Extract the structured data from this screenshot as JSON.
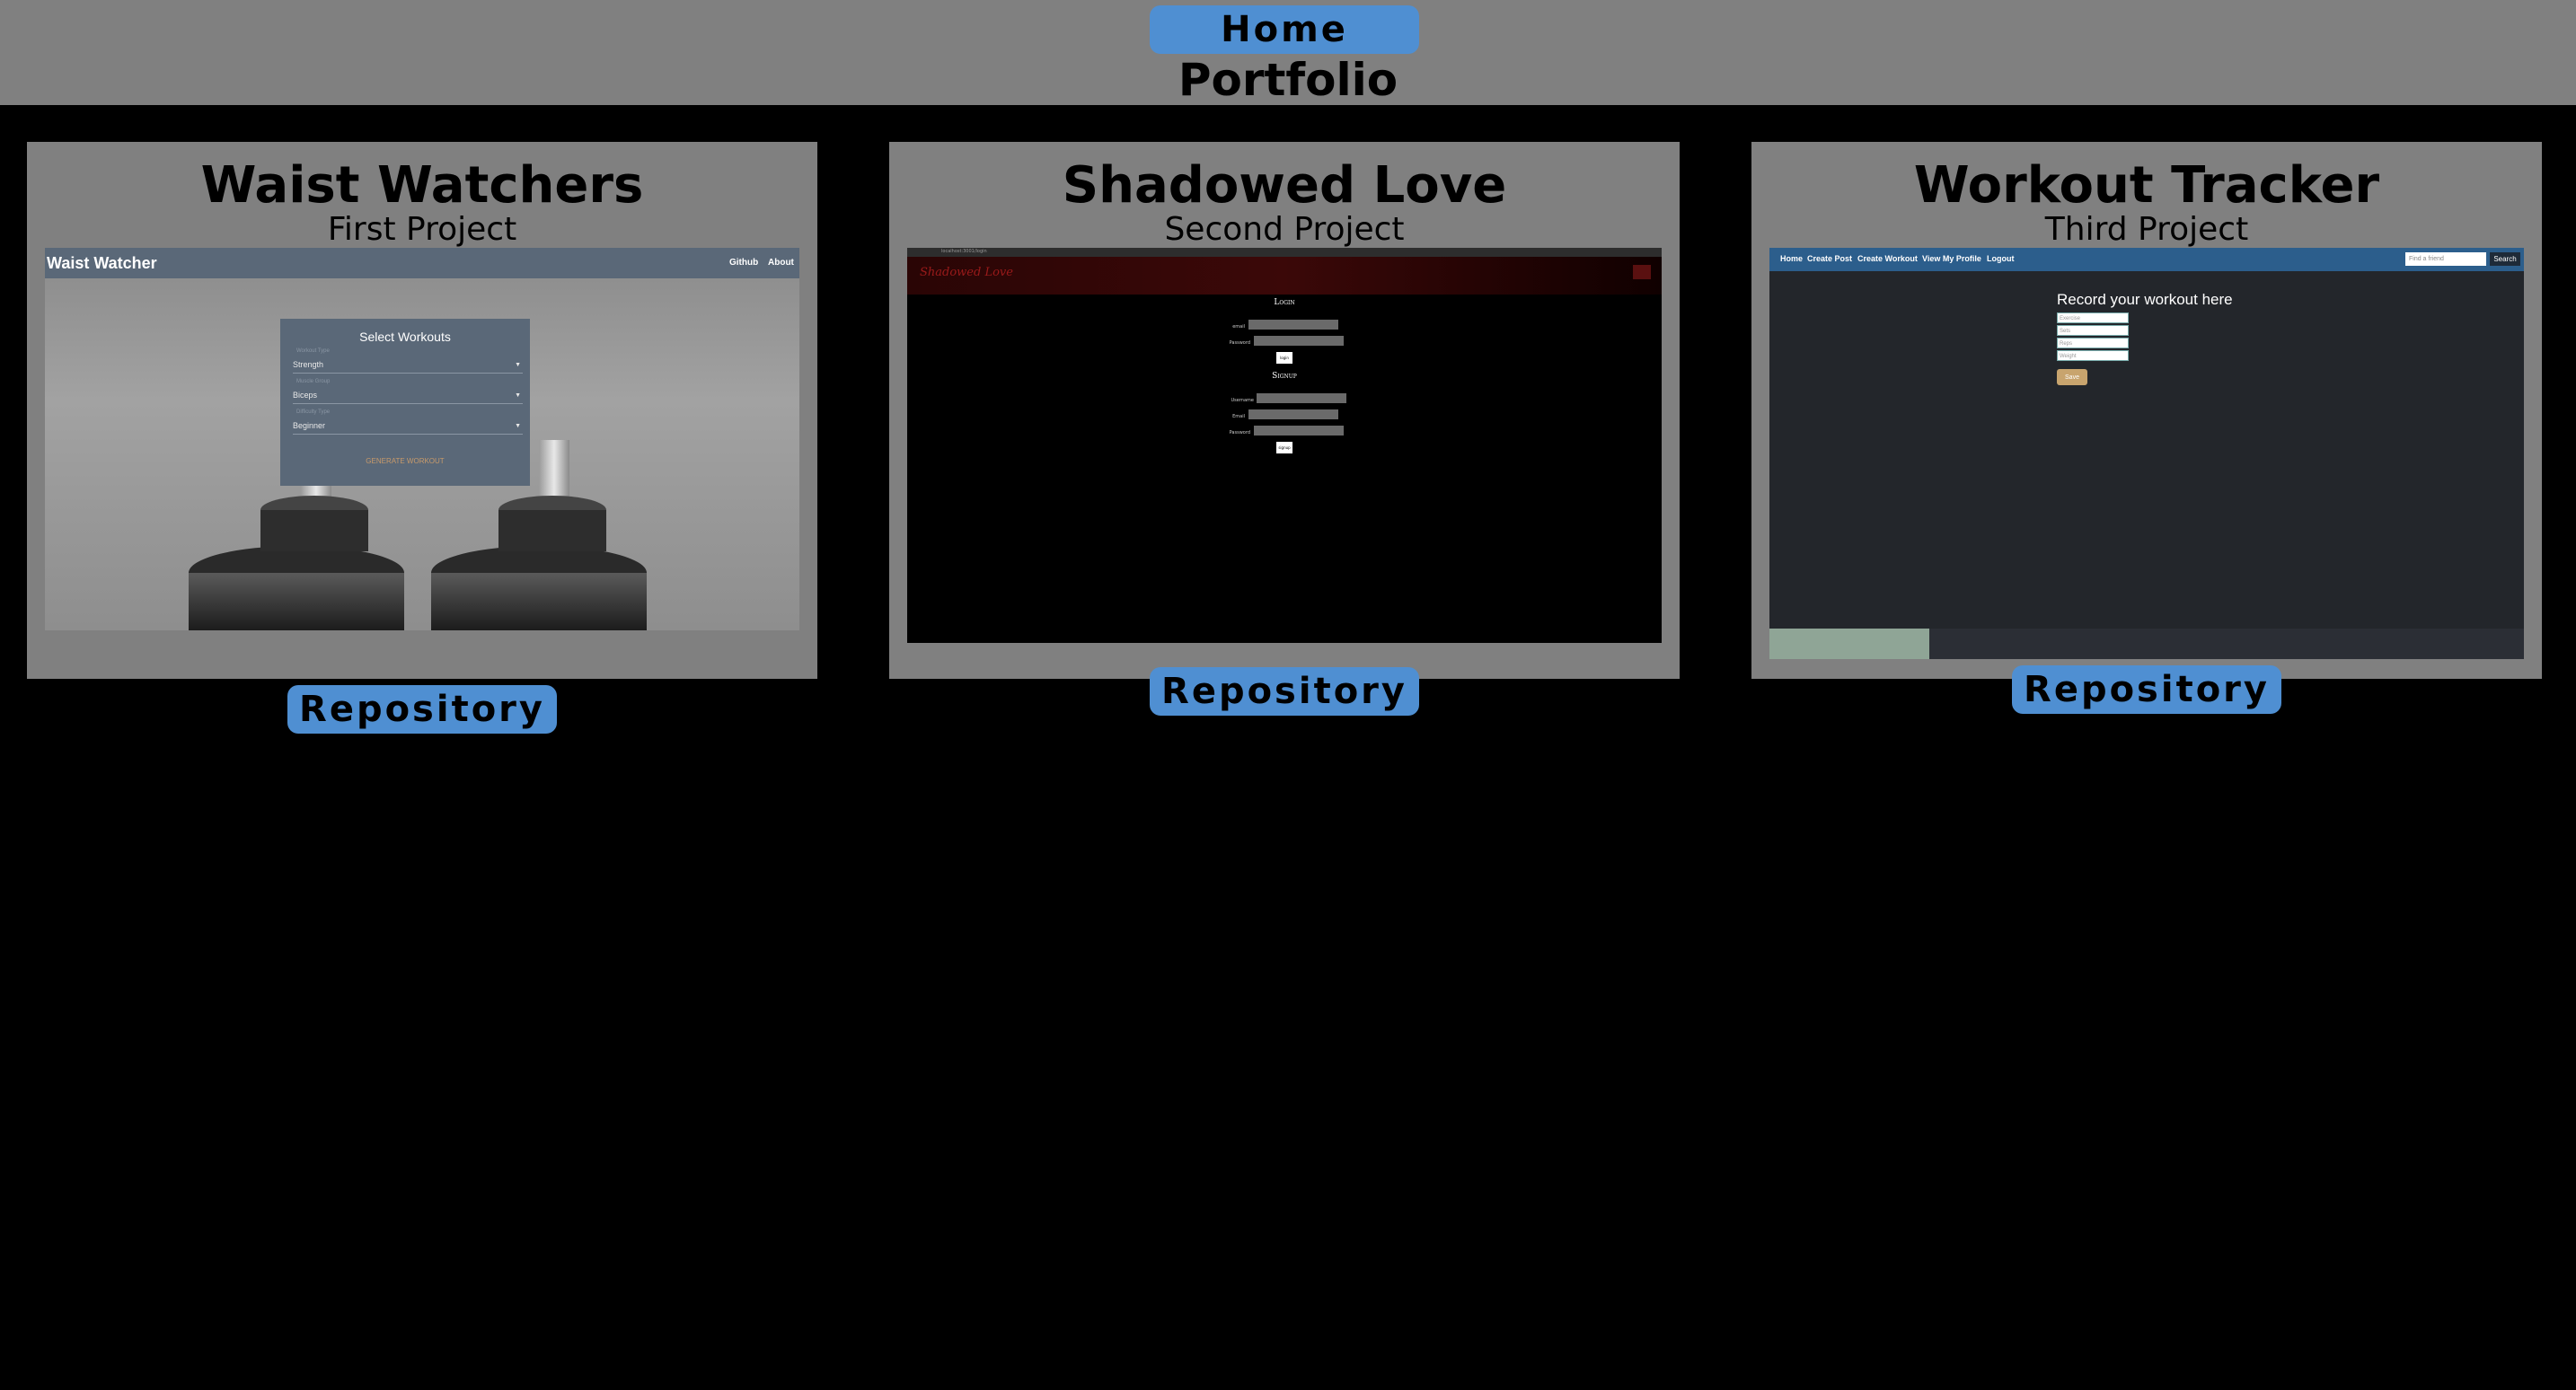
{
  "header": {
    "home_label": "Home",
    "title": "Portfolio"
  },
  "projects": [
    {
      "title": "Waist Watchers",
      "subtitle": "First Project",
      "repo_label": "Repository",
      "screenshot": {
        "brand": "Waist Watcher",
        "nav": [
          "Github",
          "About"
        ],
        "form_title": "Select Workouts",
        "fields": [
          {
            "label": "Workout Type",
            "value": "Strength"
          },
          {
            "label": "Muscle Group",
            "value": "Biceps"
          },
          {
            "label": "Difficulty Type",
            "value": "Beginner"
          }
        ],
        "generate_label": "GENERATE WORKOUT"
      }
    },
    {
      "title": "Shadowed Love",
      "subtitle": "Second Project",
      "repo_label": "Repository",
      "screenshot": {
        "url": "localhost:3001/login",
        "brand": "Shadowed Love",
        "login_heading": "Login",
        "signup_heading": "Signup",
        "login_labels": [
          "email",
          "Password"
        ],
        "login_button": "login",
        "signup_labels": [
          "Username",
          "Email",
          "Password"
        ],
        "signup_button": "signup"
      }
    },
    {
      "title": "Workout Tracker",
      "subtitle": "Third Project",
      "repo_label": "Repository",
      "screenshot": {
        "nav": [
          "Home",
          "Create Post",
          "Create Workout",
          "View My Profile",
          "Logout"
        ],
        "find_placeholder": "Find a friend",
        "search_label": "Search",
        "form_title": "Record your workout here",
        "inputs": [
          "Exercise",
          "Sets",
          "Reps",
          "Weight"
        ],
        "save_label": "Save"
      }
    }
  ]
}
